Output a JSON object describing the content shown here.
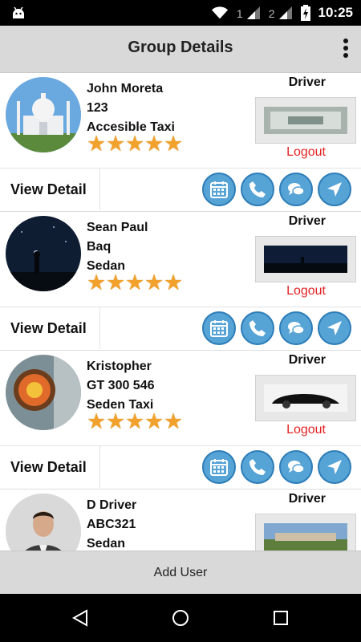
{
  "status": {
    "time": "10:25",
    "sim1": "1",
    "sim2": "2"
  },
  "header": {
    "title": "Group Details"
  },
  "members": [
    {
      "name": "John Moreta",
      "code": "123",
      "vehicle_type": "Accesible Taxi",
      "role": "Driver",
      "logout": "Logout",
      "view_detail": "View Detail",
      "rating": 5
    },
    {
      "name": "Sean Paul",
      "code": "Baq",
      "vehicle_type": "Sedan",
      "role": "Driver",
      "logout": "Logout",
      "view_detail": "View Detail",
      "rating": 5
    },
    {
      "name": "Kristopher",
      "code": "GT 300 546",
      "vehicle_type": "Seden Taxi",
      "role": "Driver",
      "logout": "Logout",
      "view_detail": "View Detail",
      "rating": 5
    },
    {
      "name": "D Driver",
      "code": "ABC321",
      "vehicle_type": "Sedan",
      "role": "Driver",
      "logout": "",
      "view_detail": "",
      "rating": 0
    }
  ],
  "action_icons": [
    "calendar-icon",
    "phone-icon",
    "chat-icon",
    "navigate-icon"
  ],
  "footer": {
    "add_user": "Add User"
  },
  "colors": {
    "accent_blue": "#56a3d6",
    "logout_red": "#e32222",
    "star": "#f2a22c",
    "bar_gray": "#d9d9d9"
  }
}
